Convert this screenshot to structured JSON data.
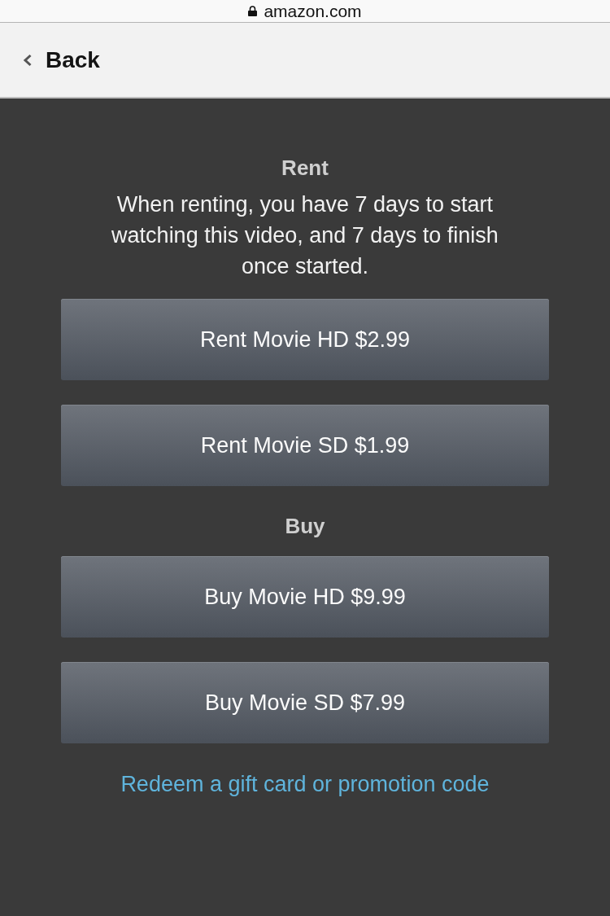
{
  "address_bar": {
    "url": "amazon.com"
  },
  "header": {
    "back_label": "Back"
  },
  "sections": [
    {
      "title": "Rent",
      "description": "When renting, you have 7 days to start watching this video, and 7 days to finish once started.",
      "options": [
        {
          "label": "Rent Movie HD $2.99"
        },
        {
          "label": "Rent Movie SD $1.99"
        }
      ]
    },
    {
      "title": "Buy",
      "options": [
        {
          "label": "Buy Movie HD $9.99"
        },
        {
          "label": "Buy Movie SD $7.99"
        }
      ]
    }
  ],
  "redeem_link": "Redeem a gift card or promotion code"
}
